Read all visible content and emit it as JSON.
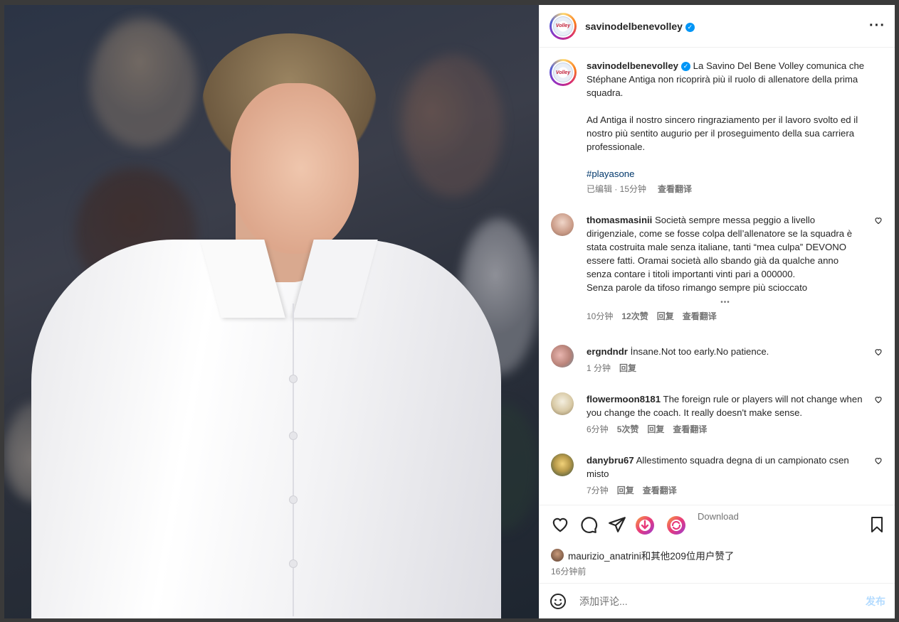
{
  "post": {
    "username": "savinodelbenevolley",
    "logo_text": "Volley"
  },
  "caption": {
    "username": "savinodelbenevolley",
    "para1": "La Savino Del Bene Volley comunica che Stéphane Antiga non ricoprirà più il ruolo di allenatore della prima squadra.",
    "para2": "Ad Antiga il nostro sincero ringraziamento per il lavoro svolto ed il nostro più sentito augurio per il proseguimento della sua carriera professionale.",
    "hashtag": "#playasone",
    "edited": "已编辑 · 15分钟",
    "translate": "查看翻译"
  },
  "comments": [
    {
      "user": "thomasmasinii",
      "text": "Società sempre messa peggio a livello dirigenziale, come se fosse colpa dell’allenatore se la squadra è stata costruita male senza italiane, tanti “mea culpa” DEVONO essere fatti. Oramai società allo sbando già da qualche anno senza contare i titoli importanti vinti pari a 000000.",
      "text2": "Senza parole da tifoso rimango sempre più scioccato",
      "ellipsis": "•••",
      "time": "10分钟",
      "likes": "12次赞",
      "reply": "回复",
      "translate": "查看翻译"
    },
    {
      "user": "ergndndr",
      "text": "İnsane.Not too early.No patience.",
      "time": "1 分钟",
      "reply": "回复"
    },
    {
      "user": "flowermoon8181",
      "text": "The foreign rule or players will not change when you change the coach. It really doesn't make sense.",
      "time": "6分钟",
      "likes": "5次赞",
      "reply": "回复",
      "translate": "查看翻译"
    },
    {
      "user": "danybru67",
      "text": "Allestimento squadra degna di un campionato csen misto",
      "time": "7分钟",
      "reply": "回复",
      "translate": "查看翻译"
    }
  ],
  "actions": {
    "download_label": "Download",
    "likes_text": "maurizio_anatrini和其他209位用户赞了",
    "post_time": "16分钟前"
  },
  "add_comment": {
    "placeholder": "添加评论...",
    "post_label": "发布"
  },
  "colors": {
    "verified": "#0095f6",
    "hashtag": "#00376b",
    "secondary_text": "#737373",
    "post_disabled": "#b3dbff"
  }
}
